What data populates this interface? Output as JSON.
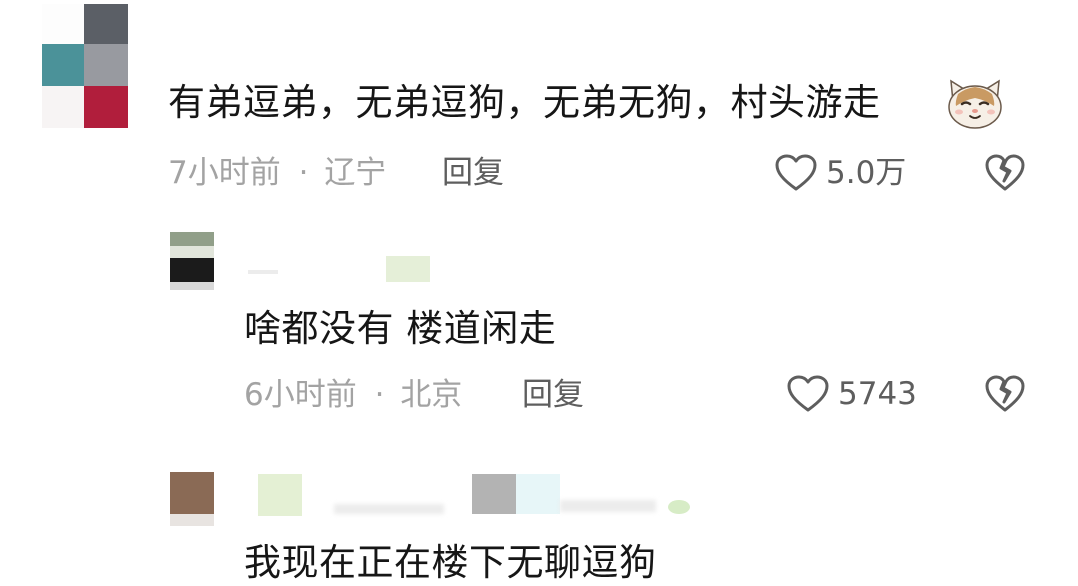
{
  "comments": [
    {
      "text": "有弟逗弟，无弟逗狗，无弟无狗，村头游走",
      "time": "7小时前",
      "separator": "·",
      "location": "辽宁",
      "reply_label": "回复",
      "like_count": "5.0万",
      "emoji": "cat-face-emoji"
    },
    {
      "text": "啥都没有 楼道闲走",
      "time": "6小时前",
      "separator": "·",
      "location": "北京",
      "reply_label": "回复",
      "like_count": "5743"
    },
    {
      "text": "我现在正在楼下无聊逗狗"
    }
  ],
  "icons": {
    "like": "heart-outline-icon",
    "dislike": "broken-heart-icon"
  },
  "colors": {
    "text_primary": "#161616",
    "text_meta": "#a3a3a3",
    "text_secondary": "#5e5e5e",
    "icon_stroke": "#5e5e5e"
  }
}
